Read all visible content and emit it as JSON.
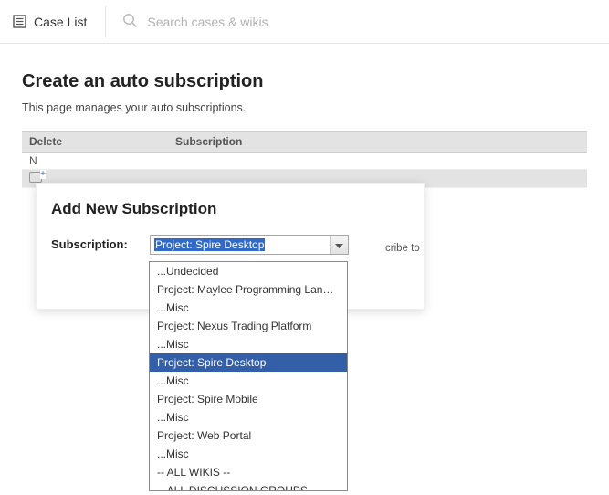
{
  "topbar": {
    "caselist_label": "Case List",
    "search_placeholder": "Search cases & wikis"
  },
  "page": {
    "title": "Create an auto subscription",
    "description": "This page manages your auto subscriptions."
  },
  "table": {
    "headers": {
      "delete": "Delete",
      "subscription": "Subscription"
    },
    "empty_row_prefix": "N"
  },
  "modal": {
    "title": "Add New Subscription",
    "field_label": "Subscription:",
    "selected_value": "Project: Spire Desktop",
    "help_fragment": "cribe to"
  },
  "dropdown": {
    "options": [
      {
        "label": "...Undecided",
        "selected": false
      },
      {
        "label": "Project: Maylee Programming Language",
        "selected": false
      },
      {
        "label": "...Misc",
        "selected": false
      },
      {
        "label": "Project: Nexus Trading Platform",
        "selected": false
      },
      {
        "label": "...Misc",
        "selected": false
      },
      {
        "label": "Project: Spire Desktop",
        "selected": true
      },
      {
        "label": "...Misc",
        "selected": false
      },
      {
        "label": "Project: Spire Mobile",
        "selected": false
      },
      {
        "label": "...Misc",
        "selected": false
      },
      {
        "label": "Project: Web Portal",
        "selected": false
      },
      {
        "label": "...Misc",
        "selected": false
      },
      {
        "label": "-- ALL WIKIS --",
        "selected": false
      },
      {
        "label": "-- ALL DISCUSSION GROUPS --",
        "selected": false
      }
    ]
  }
}
